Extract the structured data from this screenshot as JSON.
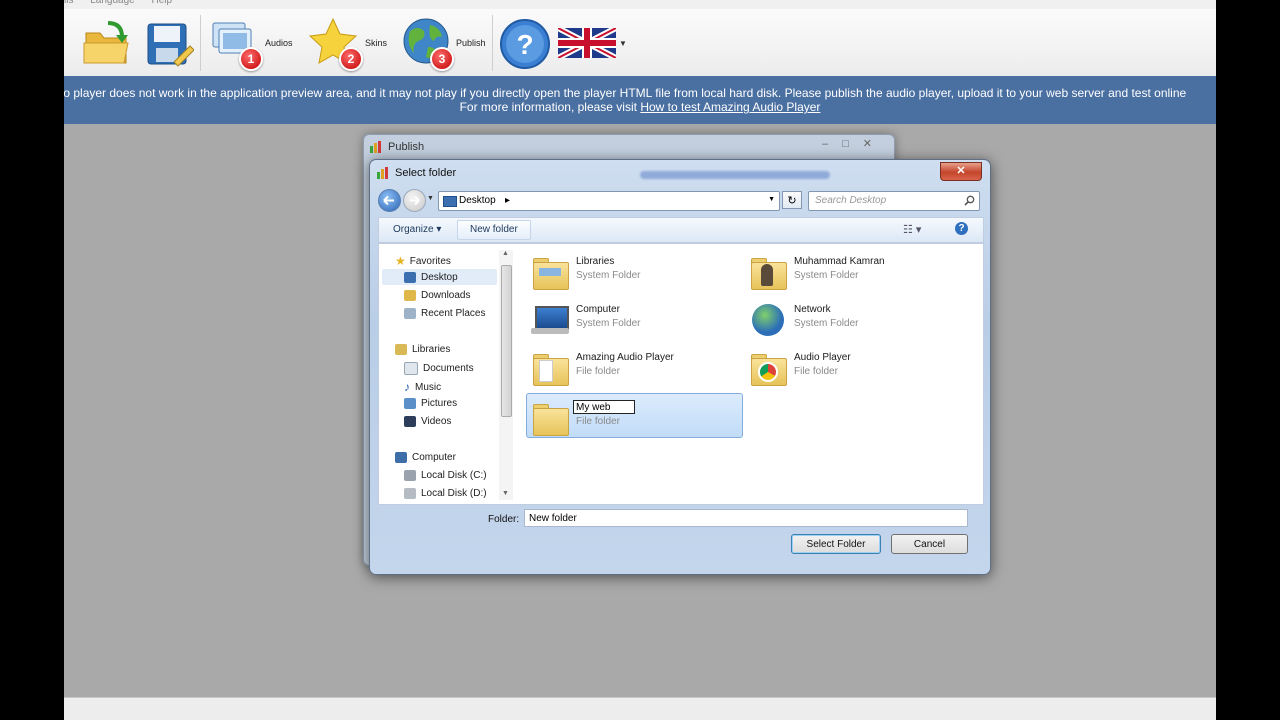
{
  "menu": {
    "items": [
      "ils",
      "Language",
      "Help"
    ]
  },
  "toolbar": {
    "audios_label": "Audios",
    "skins_label": "Skins",
    "publish_label": "Publish",
    "badge1": "1",
    "badge2": "2",
    "badge3": "3"
  },
  "banner": {
    "line1": "dio player does not work in the application preview area, and it may not play if you directly open the player HTML file from local hard disk. Please publish the audio player, upload it to your web server and test online",
    "line2_prefix": "For more information, please visit ",
    "link_text": "How to test Amazing Audio Player"
  },
  "publish_window": {
    "title": "Publish"
  },
  "dialog": {
    "title": "Select folder",
    "close_glyph": "✕",
    "address": {
      "location": "Desktop",
      "arrow": "▸"
    },
    "search_placeholder": "Search Desktop",
    "commands": {
      "organize": "Organize ▾",
      "new_folder": "New folder"
    },
    "nav": {
      "favorites": "Favorites",
      "desktop": "Desktop",
      "downloads": "Downloads",
      "recent": "Recent Places",
      "libraries": "Libraries",
      "documents": "Documents",
      "music": "Music",
      "pictures": "Pictures",
      "videos": "Videos",
      "computer": "Computer",
      "local_c": "Local Disk (C:)",
      "local_d": "Local Disk (D:)"
    },
    "items": [
      {
        "name": "Libraries",
        "type": "System Folder"
      },
      {
        "name": "Muhammad Kamran",
        "type": "System Folder"
      },
      {
        "name": "Computer",
        "type": "System Folder"
      },
      {
        "name": "Network",
        "type": "System Folder"
      },
      {
        "name": "Amazing Audio Player",
        "type": "File folder"
      },
      {
        "name": "Audio Player",
        "type": "File folder"
      },
      {
        "name": "My web",
        "type": "File folder"
      }
    ],
    "folder_label": "Folder:",
    "folder_value": "New folder",
    "select_button": "Select Folder",
    "cancel_button": "Cancel"
  },
  "colors": {
    "banner": "#4a6fa1",
    "workspace": "#a9a9a9",
    "selection": "#c1dcf8"
  }
}
